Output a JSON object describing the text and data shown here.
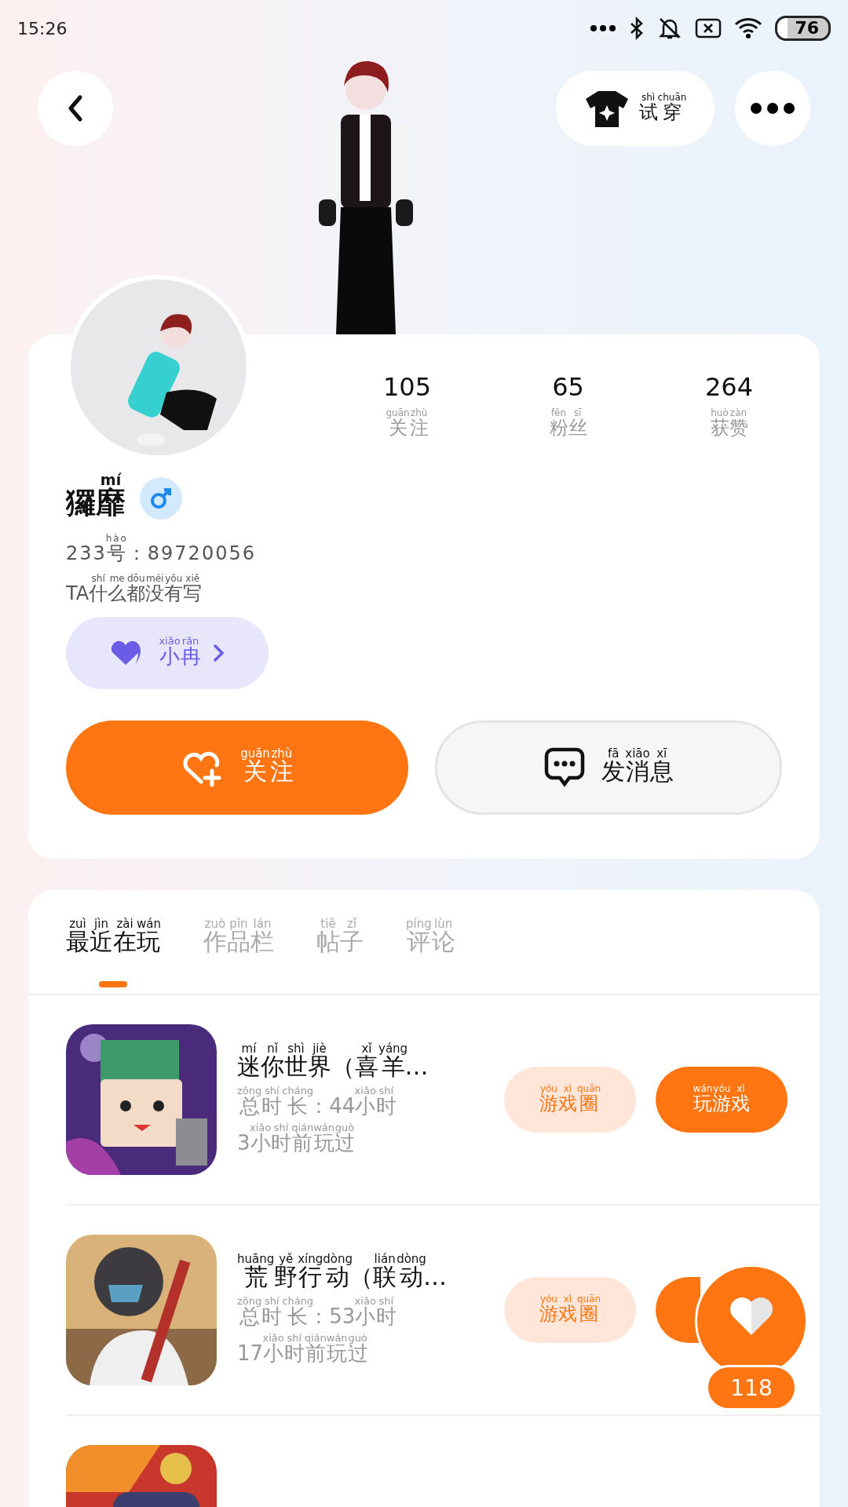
{
  "status_bar": {
    "time": "15:26",
    "battery": "76"
  },
  "header": {
    "try_on": [
      {
        "t": "试",
        "py": "shì"
      },
      {
        "t": "穿",
        "py": "chuān"
      }
    ]
  },
  "stats": [
    {
      "value": "105",
      "label": [
        {
          "t": "关",
          "py": "guān"
        },
        {
          "t": "注",
          "py": "zhù"
        }
      ]
    },
    {
      "value": "65",
      "label": [
        {
          "t": "粉",
          "py": "fěn"
        },
        {
          "t": "丝",
          "py": "sī"
        }
      ]
    },
    {
      "value": "264",
      "label": [
        {
          "t": "获",
          "py": "huò"
        },
        {
          "t": "赞",
          "py": "zàn"
        }
      ]
    }
  ],
  "profile": {
    "name": [
      {
        "t": "玀"
      },
      {
        "t": "靡",
        "py": "mí"
      }
    ],
    "id": [
      {
        "t": "233"
      },
      {
        "t": "号",
        "py": "hào"
      },
      {
        "t": "：89720056"
      }
    ],
    "bio": [
      {
        "t": "TA"
      },
      {
        "t": "什",
        "py": "shí"
      },
      {
        "t": "么",
        "py": "me"
      },
      {
        "t": "都",
        "py": "dōu"
      },
      {
        "t": "没",
        "py": "méi"
      },
      {
        "t": "有",
        "py": "yǒu"
      },
      {
        "t": "写",
        "py": "xiě"
      }
    ],
    "companion": [
      {
        "t": "小",
        "py": "xiǎo"
      },
      {
        "t": "冉",
        "py": "rǎn"
      }
    ]
  },
  "actions": {
    "follow": [
      {
        "t": "关",
        "py": "guān"
      },
      {
        "t": "注",
        "py": "zhù"
      }
    ],
    "message": [
      {
        "t": "发",
        "py": "fā"
      },
      {
        "t": "消",
        "py": "xiāo"
      },
      {
        "t": "息",
        "py": "xī"
      }
    ]
  },
  "tabs": [
    {
      "label": [
        {
          "t": "最",
          "py": "zuì"
        },
        {
          "t": "近",
          "py": "jìn"
        },
        {
          "t": "在",
          "py": "zài"
        },
        {
          "t": "玩",
          "py": "wán"
        }
      ],
      "selected": true
    },
    {
      "label": [
        {
          "t": "作",
          "py": "zuò"
        },
        {
          "t": "品",
          "py": "pǐn"
        },
        {
          "t": "栏",
          "py": "lán"
        }
      ],
      "selected": false
    },
    {
      "label": [
        {
          "t": "帖",
          "py": "tiě"
        },
        {
          "t": "子",
          "py": "zǐ"
        }
      ],
      "selected": false
    },
    {
      "label": [
        {
          "t": "评",
          "py": "píng"
        },
        {
          "t": "论",
          "py": "lùn"
        }
      ],
      "selected": false
    }
  ],
  "games": [
    {
      "icon": {
        "kind": "picture"
      },
      "title": [
        {
          "t": "迷",
          "py": "mí"
        },
        {
          "t": "你",
          "py": "nǐ"
        },
        {
          "t": "世",
          "py": "shì"
        },
        {
          "t": "界",
          "py": "jiè"
        },
        {
          "t": "（"
        },
        {
          "t": "喜",
          "py": "xǐ"
        },
        {
          "t": "羊",
          "py": "yáng"
        },
        {
          "t": "…"
        }
      ],
      "playtime": [
        {
          "t": "总",
          "py": "zǒng"
        },
        {
          "t": "时",
          "py": "shí"
        },
        {
          "t": "长",
          "py": "cháng"
        },
        {
          "t": "：44"
        },
        {
          "t": "小",
          "py": "xiǎo"
        },
        {
          "t": "时",
          "py": "shí"
        }
      ],
      "last_played": [
        {
          "t": "3"
        },
        {
          "t": "小",
          "py": "xiǎo"
        },
        {
          "t": "时",
          "py": "shí"
        },
        {
          "t": "前",
          "py": "qián"
        },
        {
          "t": "玩",
          "py": "wán"
        },
        {
          "t": "过",
          "py": "guò"
        }
      ],
      "circle_label": [
        {
          "t": "游",
          "py": "yóu"
        },
        {
          "t": "戏",
          "py": "xì"
        },
        {
          "t": "圈",
          "py": "quān"
        }
      ],
      "play_label": [
        {
          "t": "玩",
          "py": "wán"
        },
        {
          "t": "游",
          "py": "yóu"
        },
        {
          "t": "戏",
          "py": "xì"
        }
      ]
    },
    {
      "icon": {
        "kind": "picture"
      },
      "title": [
        {
          "t": "荒",
          "py": "huāng"
        },
        {
          "t": "野",
          "py": "yě"
        },
        {
          "t": "行",
          "py": "xíng"
        },
        {
          "t": "动",
          "py": "dòng"
        },
        {
          "t": "（"
        },
        {
          "t": "联",
          "py": "lián"
        },
        {
          "t": "动",
          "py": "dòng"
        },
        {
          "t": "…"
        }
      ],
      "playtime": [
        {
          "t": "总",
          "py": "zǒng"
        },
        {
          "t": "时",
          "py": "shí"
        },
        {
          "t": "长",
          "py": "cháng"
        },
        {
          "t": "：53"
        },
        {
          "t": "小",
          "py": "xiǎo"
        },
        {
          "t": "时",
          "py": "shí"
        }
      ],
      "last_played": [
        {
          "t": "17"
        },
        {
          "t": "小",
          "py": "xiǎo"
        },
        {
          "t": "时",
          "py": "shí"
        },
        {
          "t": "前",
          "py": "qián"
        },
        {
          "t": "玩",
          "py": "wán"
        },
        {
          "t": "过",
          "py": "guò"
        }
      ],
      "circle_label": [
        {
          "t": "游",
          "py": "yóu"
        },
        {
          "t": "戏",
          "py": "xì"
        },
        {
          "t": "圈",
          "py": "quān"
        }
      ],
      "play_button": true
    },
    {
      "icon": {
        "kind": "picture"
      }
    }
  ],
  "like_fab": {
    "count": "118"
  }
}
